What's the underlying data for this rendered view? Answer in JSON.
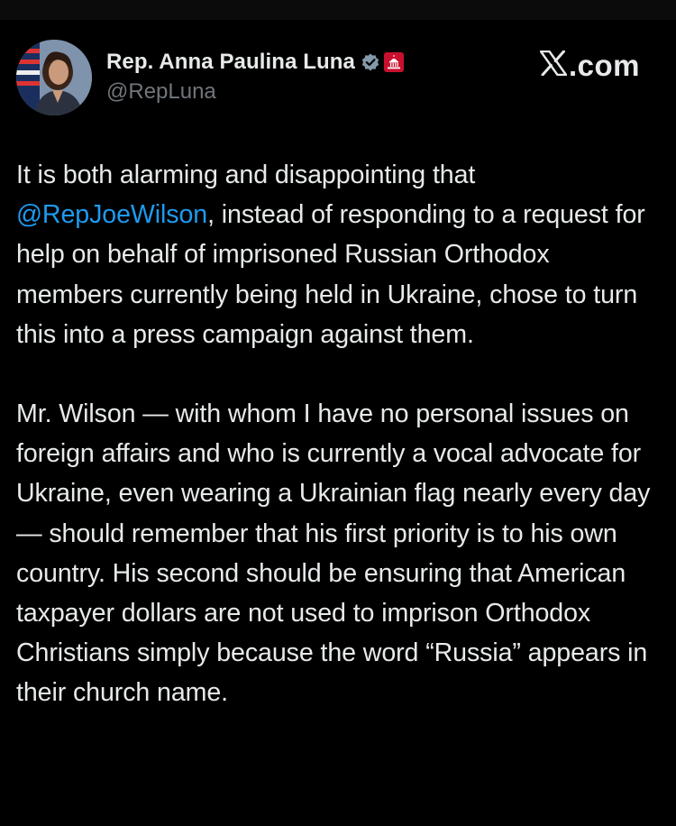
{
  "author": {
    "display_name": "Rep. Anna Paulina Luna",
    "handle": "@RepLuna",
    "verified_icon": "verified-badge-icon",
    "affiliation_icon": "us-capitol-badge-icon"
  },
  "brand": {
    "wordmark": ".com",
    "logo_icon": "x-logo-icon"
  },
  "tweet": {
    "p1_before": "It is both alarming and disappointing that ",
    "p1_mention": "@RepJoeWilson",
    "p1_after": ", instead of responding to a request for help on behalf of imprisoned Russian Orthodox members currently being held in Ukraine, chose to turn this into a press campaign against them.",
    "p2": "Mr. Wilson — with whom I have no personal issues on foreign affairs and who is currently a vocal advocate for Ukraine, even wearing a Ukrainian flag nearly every day — should remember that his first priority is to his own country. His second should be ensuring that American taxpayer dollars are not used to imprison Orthodox Christians simply because the word “Russia” appears in their church name."
  },
  "colors": {
    "background": "#000000",
    "text": "#e7e9ea",
    "secondary": "#71767b",
    "link": "#1d9bf0",
    "verified": "#829aab",
    "badge": "#c8102e"
  }
}
